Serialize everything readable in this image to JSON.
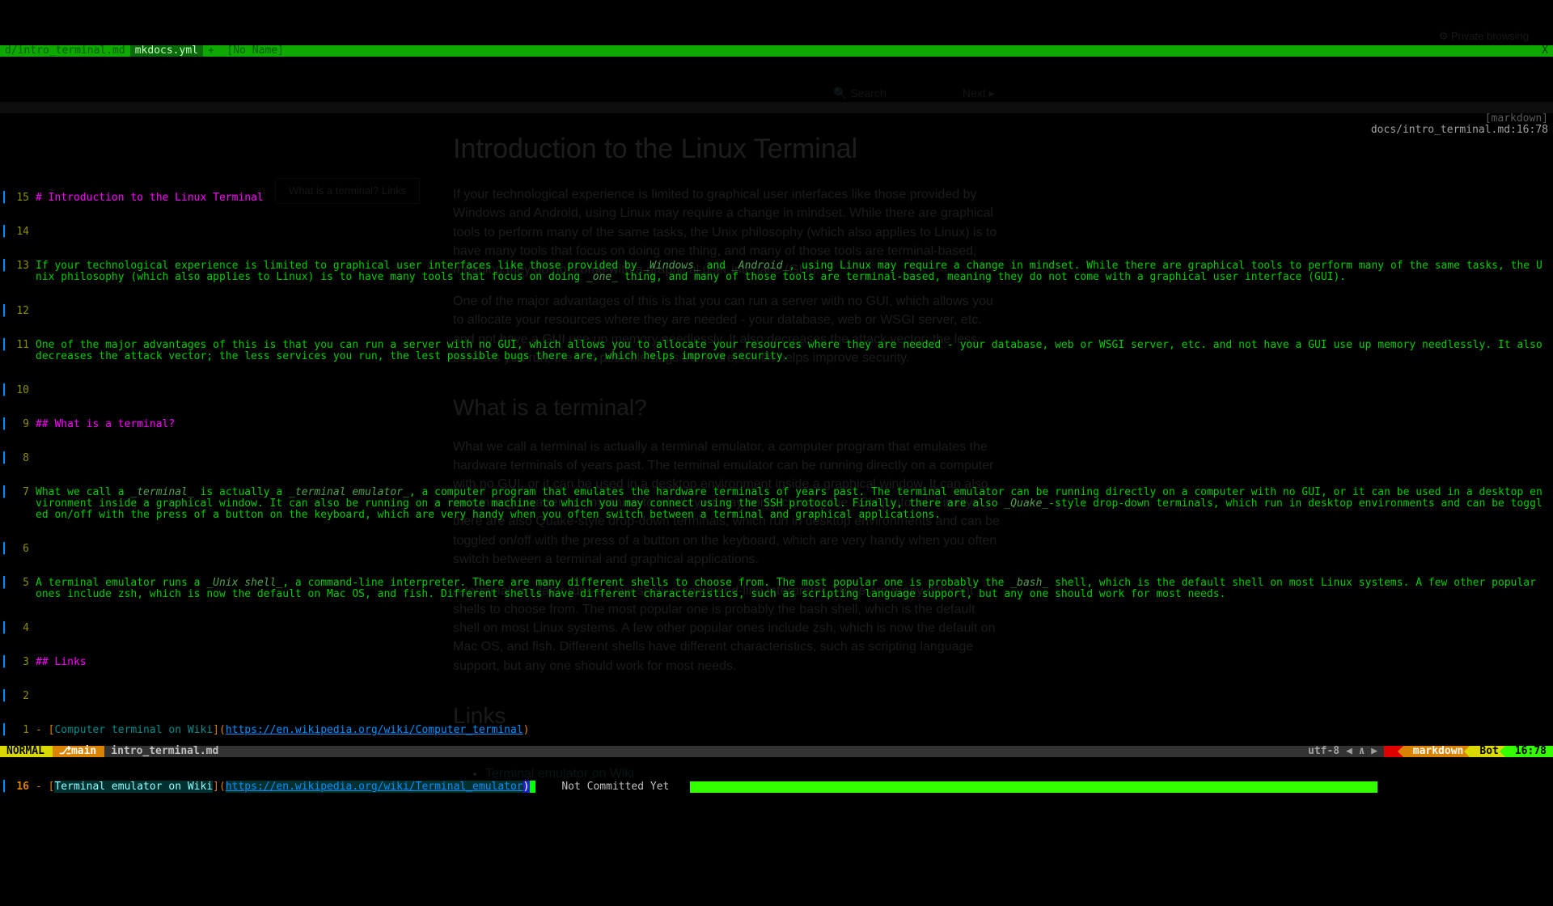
{
  "tabs": {
    "t1": "d/intro_terminal.md",
    "t2": "mkdocs.yml",
    "t3": "+  [No Name]",
    "close": "X"
  },
  "winbar": {
    "ft": "[markdown]",
    "path": "docs/intro_terminal.md:16:78"
  },
  "lines": {
    "n15": "15",
    "l15": "# Introduction to the Linux Terminal",
    "n14": "14",
    "n13": "13",
    "l13a": "If your technological experience is limited to graphical user interfaces like those provided by ",
    "l13w": "_Windows_",
    "l13b": " and ",
    "l13an": "_Android_",
    "l13c": ", using Linux may require a change in mindset. While there are graphical tools to perform many of the same tasks, the Unix philosophy (which also applies to Linux) is to have many tools that focus on doing ",
    "l13one": "_one_",
    "l13d": " thing, and many of those tools are terminal-based, meaning they do not come with a graphical user interface (GUI).",
    "n12": "12",
    "n11": "11",
    "l11": "One of the major advantages of this is that you can run a server with no GUI, which allows you to allocate your resources where they are needed - your database, web or WSGI server, etc. and not have a GUI use up memory needlessly. It also decreases the attack vector; the less services you run, the lest possible bugs there are, which helps improve security.",
    "n10": "10",
    "n9": "9",
    "l9": "## What is a terminal?",
    "n8": "8",
    "n7": "7",
    "l7a": "What we call a ",
    "l7t": "_terminal_",
    "l7b": " is actually a ",
    "l7te": "_terminal emulator_",
    "l7c": ", a computer program that emulates the hardware terminals of years past. The terminal emulator can be running directly on a computer with no GUI, or it can be used in a desktop environment inside a graphical window. It can also be running on a remote machine to which you may connect using the SSH protocol. Finally, there are also ",
    "l7q": "_Quake_",
    "l7d": "-style drop-down terminals, which run in desktop environments and can be toggled on/off with the press of a button on the keyboard, which are very handy when you often switch between a terminal and graphical applications.",
    "n6": "6",
    "n5": "5",
    "l5a": "A terminal emulator runs a ",
    "l5u": "_Unix shell_",
    "l5b": ", a command-line interpreter. There are many different shells to choose from. The most popular one is probably the ",
    "l5bash": "_bash_",
    "l5c": " shell, which is the default shell on most Linux systems. A few other popular ones include zsh, which is now the default on Mac OS, and fish. Different shells have different characteristics, such as scripting language support, but any one should work for most needs.",
    "n4": "4",
    "n3": "3",
    "l3": "## Links",
    "n2": "2",
    "n1": "1",
    "l1dash": "- ",
    "l1open": "[",
    "l1link": "Computer terminal on Wiki",
    "l1mid": "](",
    "l1url": "https://en.wikipedia.org/wiki/Computer_terminal",
    "l1close": ")",
    "n16": "16",
    "l16dash": "- ",
    "l16open": "[",
    "l16link": "Terminal emulator on Wiki",
    "l16mid": "](",
    "l16url": "https://en.wikipedia.org/wiki/Terminal_emulator",
    "l16close": ")"
  },
  "blame": "Not Committed Yet",
  "status": {
    "mode": "NORMAL",
    "branch_icon": "⎇",
    "branch": "main",
    "file": "intro_terminal.md",
    "enc": "utf-8 ◀ ∧ ▶",
    "ft": "markdown",
    "pos": "Bot",
    "ln": "16:78"
  },
  "ghost": {
    "priv": "⚙ Private browsing",
    "search": "🔍 Search",
    "next": "Next ▸",
    "h1": "Introduction to the Linux Terminal",
    "p1": "If your technological experience is limited to graphical user interfaces like those provided by Windows and Android, using Linux may require a change in mindset. While there are graphical tools to perform many of the same tasks, the Unix philosophy (which also applies to Linux) is to have many tools that focus on doing one thing, and many of those tools are terminal-based, meaning they do not come with a graphical user interface (GUI).",
    "p2": "One of the major advantages of this is that you can run a server with no GUI, which allows you to allocate your resources where they are needed - your database, web or WSGI server, etc. and not have a GUI use up memory needlessly. It also decreases the attack vector; the less services you run, the lest possible bugs there are, which helps improve security.",
    "h2a": "What is a terminal?",
    "p3": "What we call a terminal is actually a terminal emulator, a computer program that emulates the hardware terminals of years past. The terminal emulator can be running directly on a computer with no GUI, or it can be used in a desktop environment inside a graphical window. It can also be running on a remote machine to which you may connect using the SSH protocol. Finally, there are also Quake-style drop-down terminals, which run in desktop environments and can be toggled on/off with the press of a button on the keyboard, which are very handy when you often switch between a terminal and graphical applications.",
    "p4": "A terminal emulator runs a Unix shell, a command-line interpreter. There are many different shells to choose from. The most popular one is probably the bash shell, which is the default shell on most Linux systems. A few other popular ones include zsh, which is now the default on Mac OS, and fish. Different shells have different characteristics, such as scripting language support, but any one should work for most needs.",
    "h2b": "Links",
    "li1": "Computer terminal on Wiki",
    "li2": "Terminal emulator on Wiki",
    "sideq": "What is a terminal?\nLinks"
  }
}
